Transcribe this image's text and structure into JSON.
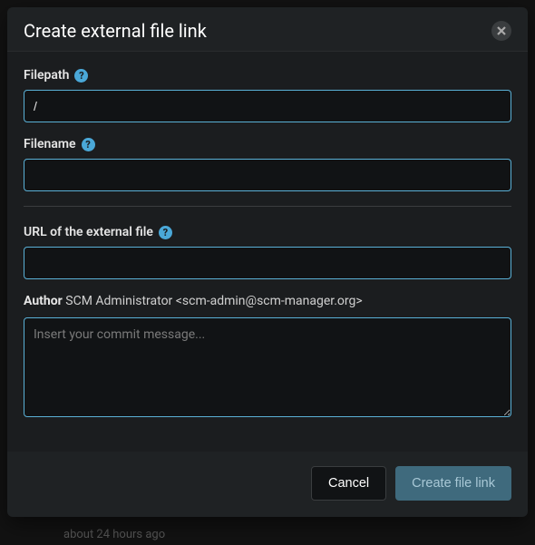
{
  "modal": {
    "title": "Create external file link",
    "filepath": {
      "label": "Filepath",
      "value": "/"
    },
    "filename": {
      "label": "Filename",
      "value": ""
    },
    "url": {
      "label": "URL of the external file",
      "value": ""
    },
    "author": {
      "label": "Author",
      "value": "SCM Administrator <scm-admin@scm-manager.org>"
    },
    "commit": {
      "placeholder": "Insert your commit message...",
      "value": ""
    },
    "buttons": {
      "cancel": "Cancel",
      "submit": "Create file link"
    }
  },
  "backdrop": {
    "text": "about 24 hours ago"
  }
}
